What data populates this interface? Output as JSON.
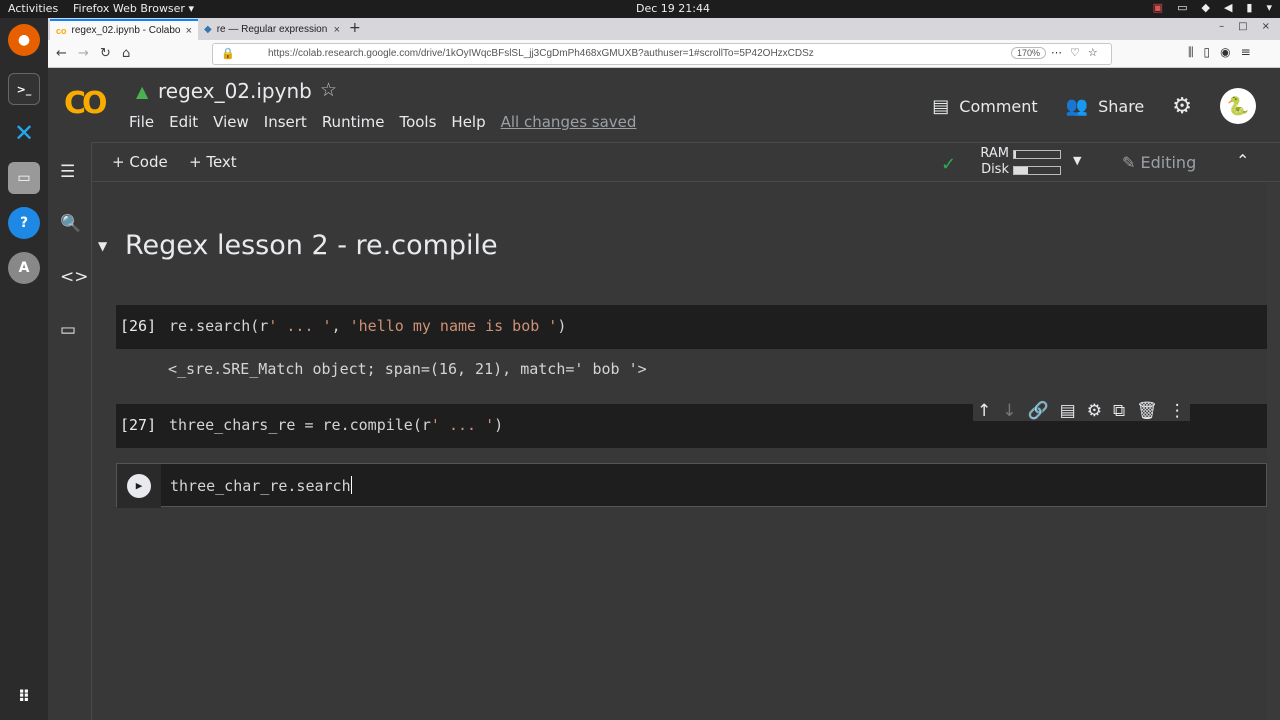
{
  "os": {
    "activities": "Activities",
    "app_menu": "Firefox Web Browser ▾",
    "clock": "Dec 19  21:44"
  },
  "browser": {
    "tabs": [
      {
        "label": "regex_02.ipynb - Colabo"
      },
      {
        "label": "re — Regular expression"
      }
    ],
    "url": "https://colab.research.google.com/drive/1kOyIWqcBFslSL_jj3CgDmPh468xGMUXB?authuser=1#scrollTo=5P42OHzxCDSz",
    "zoom": "170%"
  },
  "colab": {
    "logo": "CO",
    "title": "regex_02.ipynb",
    "menu": [
      "File",
      "Edit",
      "View",
      "Insert",
      "Runtime",
      "Tools",
      "Help"
    ],
    "saved_status": "All changes saved",
    "comment_label": "Comment",
    "share_label": "Share",
    "toolbar": {
      "add_code": "+ Code",
      "add_text": "+ Text",
      "ram_label": "RAM",
      "disk_label": "Disk",
      "ram_fraction": 0.05,
      "disk_fraction": 0.3,
      "editing_label": "Editing"
    }
  },
  "notebook": {
    "heading": "Regex lesson 2 - re.compile",
    "cells": [
      {
        "num": "[26]",
        "code_pre": "re.search(r",
        "str1": "' ... '",
        "mid": ", ",
        "str2": "'hello my name is bob '",
        "code_post": ")"
      },
      {
        "num": "[27]",
        "code_pre": "three_chars_re = re.compile(r",
        "str1": "' ... '",
        "code_post": ")"
      },
      {
        "code": "three_char_re.search"
      }
    ],
    "output": "<_sre.SRE_Match object; span=(16, 21), match=' bob '>"
  }
}
